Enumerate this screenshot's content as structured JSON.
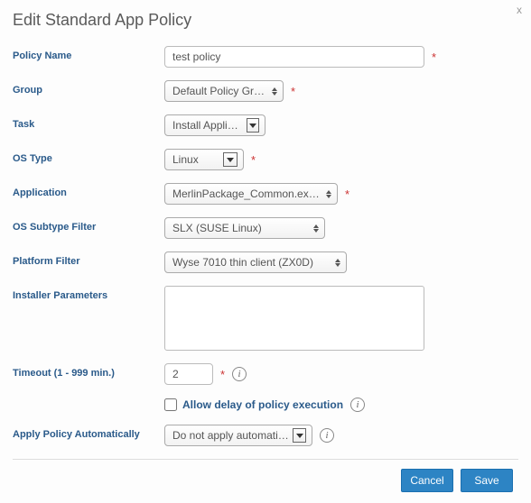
{
  "dialog": {
    "title": "Edit Standard App Policy",
    "close": "x"
  },
  "labels": {
    "policyName": "Policy Name",
    "group": "Group",
    "task": "Task",
    "osType": "OS Type",
    "application": "Application",
    "osSubtype": "OS Subtype Filter",
    "platform": "Platform Filter",
    "installer": "Installer Parameters",
    "timeout": "Timeout (1 - 999 min.)",
    "allowDelay": "Allow delay of policy execution",
    "applyAuto": "Apply Policy Automatically"
  },
  "values": {
    "policyName": "test policy",
    "group": "Default Policy Group",
    "task": "Install Application",
    "osType": "Linux",
    "application": "MerlinPackage_Common.exe (Loc",
    "osSubtype": "SLX (SUSE Linux)",
    "platform": "Wyse 7010 thin client (ZX0D)",
    "installer": "",
    "timeout": "2",
    "allowDelayChecked": false,
    "applyAuto": "Do not apply automatically"
  },
  "required": {
    "policyName": true,
    "group": true,
    "osType": true,
    "application": true,
    "timeout": true
  },
  "footer": {
    "cancel": "Cancel",
    "save": "Save"
  }
}
